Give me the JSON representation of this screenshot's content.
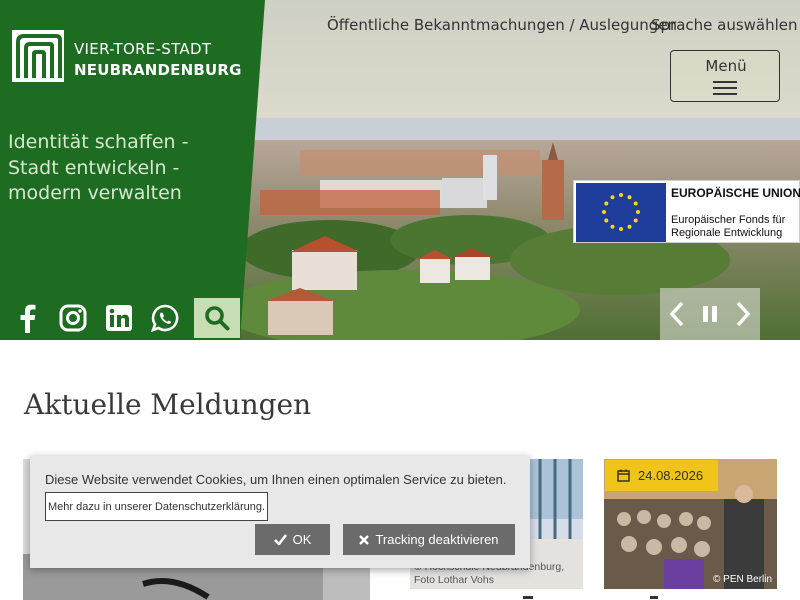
{
  "header": {
    "logo": {
      "line1": "VIER-TORE-STADT",
      "line2": "NEUBRANDENBURG"
    },
    "tagline": "Identität schaffen - Stadt entwickeln - modern verwalten",
    "top_links": {
      "announcements": "Öffentliche Bekanntmachungen / Auslegungen",
      "language": "Sprache auswählen"
    },
    "menu_label": "Menü",
    "social": [
      "facebook-icon",
      "instagram-icon",
      "linkedin-icon",
      "whatsapp-icon"
    ],
    "search_icon": "search-icon"
  },
  "eu_banner": {
    "title": "EUROPÄISCHE UNION",
    "subtitle_line1": "Europäischer Fonds für",
    "subtitle_line2": "Regionale Entwicklung"
  },
  "slider": {
    "controls": [
      "chevron-left-icon",
      "pause-icon",
      "chevron-right-icon"
    ]
  },
  "news": {
    "heading": "Aktuelle Meldungen",
    "cards": [
      {
        "credit": ""
      },
      {
        "credit": "© Hochschule Neubrandenburg, Foto Lothar Vohs"
      },
      {
        "date": "24.08.2026",
        "credit": "© PEN Berlin"
      }
    ]
  },
  "cookie_banner": {
    "text": "Diese Website verwendet Cookies, um Ihnen einen optimalen Service zu bieten.",
    "privacy_link": "Mehr dazu in unserer Datenschutzerklärung.",
    "ok_label": "OK",
    "tracking_label": "Tracking deaktivieren"
  },
  "colors": {
    "brand_green": "#1e6b22",
    "accent_yellow": "#f0c419",
    "search_bg": "#c8ddb3"
  }
}
